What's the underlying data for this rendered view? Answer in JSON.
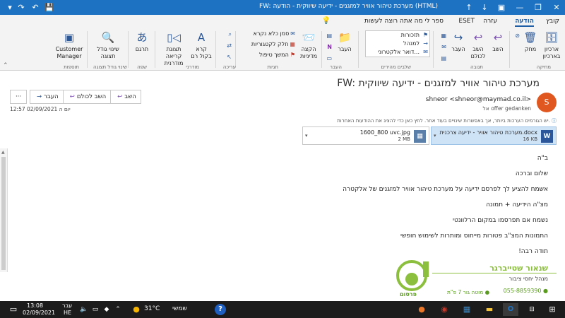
{
  "window": {
    "title": "FW: מערכת טיהור אוויר למזגנים - ידיעה שיווקית - הודעה (HTML)",
    "controls": {
      "close": "✕",
      "maximize": "❐",
      "minimize": "—"
    },
    "quick_access": {
      "save": "💾",
      "undo": "↶",
      "redo": "↷",
      "up": "↑",
      "down": "↓"
    }
  },
  "tabs": [
    {
      "label": "קובץ"
    },
    {
      "label": "הודעה"
    },
    {
      "label": "עזרה"
    },
    {
      "label": "ESET"
    },
    {
      "label": "ספר לי מה אתה רוצה לעשות"
    }
  ],
  "ribbon": {
    "delete_group": {
      "label": "מחיקה",
      "delete": "מחק",
      "archive": "ארכיון בארכיון",
      "ignore": "⊘"
    },
    "respond_group": {
      "label": "תגובה",
      "reply": "השב",
      "reply_all": "השב לכולם",
      "forward": "העבר"
    },
    "quick_steps_group": {
      "label": "שלבים מהירים",
      "items": [
        "תזכורות",
        "למנהל",
        "דואר אלקטרוני..."
      ]
    },
    "move_group": {
      "label": "העבר",
      "move": "העבר",
      "onenote": "N"
    },
    "tags_group": {
      "label": "תגיות",
      "policy": "הקצה מדיניות",
      "mark_read": "סמן כלא נקרא",
      "categorize": "חלק לקטגוריות",
      "follow_up": "המשך טיפול"
    },
    "editing_group": {
      "label": "עריכה"
    },
    "speech_group": {
      "label": "מודרני",
      "read_aloud": "קרא בקול רם",
      "immersive": "תצוגת קריאה מודרנית"
    },
    "language_group": {
      "label": "שפה",
      "translate": "תרגם"
    },
    "zoom_group": {
      "label": "שינוי גודל תצוגה",
      "zoom": "שינוי גודל תצוגה"
    },
    "addin_group": {
      "label": "תוספות",
      "customer_manager": "Customer Manager"
    }
  },
  "message": {
    "subject": "FW: מערכת טיהור אוויר למזגנים - ידיעה שיווקית",
    "actions": {
      "reply": "השב",
      "reply_all": "השב לכולם",
      "forward": "העבר",
      "more": "···"
    },
    "avatar_initial": "S",
    "sender": "shneor <shneor@maymad.co.il>",
    "to_label": "אל",
    "to_value": "offer gedanken",
    "datetime": "יום ה 02/09/2021 12:57",
    "info": "אם קיימות בעיות בתצוגה של הודעה זו, לחץ כאן כדי להציג אותה בדפדפן אינטרנט. שמירה אינה קשורה לבעיות הצגה אחרות, אך ייתכנו שינויים בעוד ההודעה.",
    "info_short": "יש הגורמים הערכות ביותר, אך באפשרות שינויים בעוד אחר. לחץ כאן כדי להציג את ההודעות האחרות.",
    "attachments": [
      {
        "name": "מערכת טיהור אוויר - ידיעה צרכנית.docx",
        "size": "16 KB",
        "type": "W",
        "color": "#2b579a"
      },
      {
        "name": "1600_800 uvc.jpg",
        "size": "2 MB",
        "type": "▦",
        "color": "#5a7fa8"
      }
    ]
  },
  "body": {
    "lines": [
      "ב\"ה",
      "שלום וברכה",
      "אשמח להציע לך לפרסם ידיעה על מערכת טיהור אוויר למזגנים של אלקטרה",
      "מצ\"ה הידיעה + תמונה",
      "נשמח אם תפרסמו במקום הרלוונטי",
      "התמונות המצ\"ב פטורות מייחוס ומותרות לשימוש חופשי",
      "תודה רבה!"
    ],
    "signature": {
      "name": "שנאור שטייברגר",
      "title": "מנהל יחסי ציבור",
      "phone": "055-8859390",
      "address": "מוטה גור 7 פ\"ת",
      "logo_text": "פרסום"
    }
  },
  "taskbar": {
    "time": "13:08",
    "date": "02/09/2021",
    "lang1": "עבר",
    "lang2": "HE",
    "weather": "31°C",
    "weather_desc": "שמשי",
    "help": "?",
    "notif": "▭"
  },
  "colors": {
    "titlebar": "#1e72c2",
    "accent": "#1e5fa8",
    "avatar": "#e0571f",
    "signature": "#8bbf3d"
  }
}
